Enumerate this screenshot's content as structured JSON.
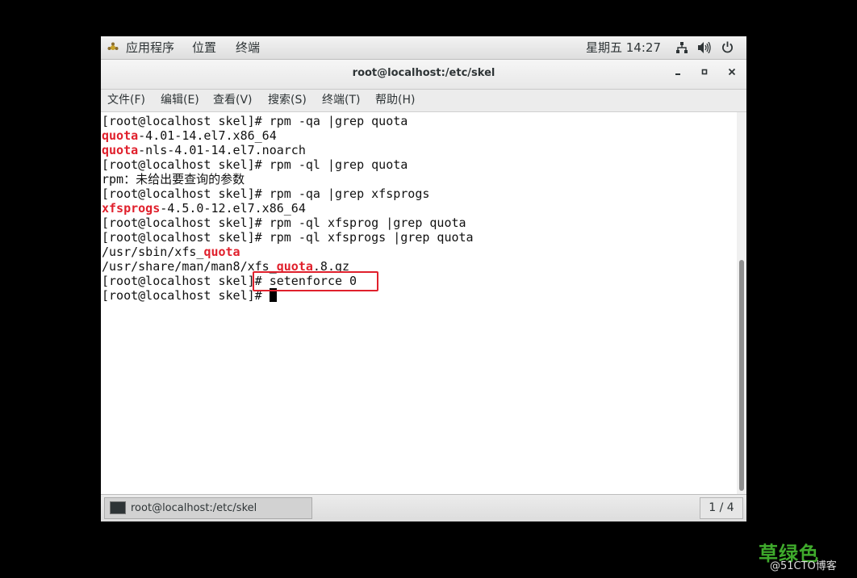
{
  "top_panel": {
    "apps_label": "应用程序",
    "places_label": "位置",
    "terminal_label": "终端",
    "clock": "星期五 14:27"
  },
  "window": {
    "title": "root@localhost:/etc/skel"
  },
  "menubar": {
    "items": [
      "文件(F)",
      "编辑(E)",
      "查看(V)",
      "搜索(S)",
      "终端(T)",
      "帮助(H)"
    ]
  },
  "terminal": {
    "lines": [
      {
        "parts": [
          {
            "t": "[root@localhost skel]# rpm -qa |grep quota"
          }
        ]
      },
      {
        "parts": [
          {
            "t": "quota",
            "red": true
          },
          {
            "t": "-4.01-14.el7.x86_64"
          }
        ]
      },
      {
        "parts": [
          {
            "t": "quota",
            "red": true
          },
          {
            "t": "-nls-4.01-14.el7.noarch"
          }
        ]
      },
      {
        "parts": [
          {
            "t": "[root@localhost skel]# rpm -ql |grep quota"
          }
        ]
      },
      {
        "parts": [
          {
            "t": "rpm：未给出要查询的参数"
          }
        ]
      },
      {
        "parts": [
          {
            "t": "[root@localhost skel]# rpm -qa |grep xfsprogs"
          }
        ]
      },
      {
        "parts": [
          {
            "t": "xfsprogs",
            "red": true
          },
          {
            "t": "-4.5.0-12.el7.x86_64"
          }
        ]
      },
      {
        "parts": [
          {
            "t": "[root@localhost skel]# rpm -ql xfsprog |grep quota"
          }
        ]
      },
      {
        "parts": [
          {
            "t": "[root@localhost skel]# rpm -ql xfsprogs |grep quota"
          }
        ]
      },
      {
        "parts": [
          {
            "t": "/usr/sbin/xfs_"
          },
          {
            "t": "quota",
            "red": true
          }
        ]
      },
      {
        "parts": [
          {
            "t": "/usr/share/man/man8/xfs_"
          },
          {
            "t": "quota",
            "red": true
          },
          {
            "t": ".8.gz"
          }
        ]
      },
      {
        "parts": [
          {
            "t": "[root@localhost skel]# setenforce 0"
          }
        ]
      },
      {
        "parts": [
          {
            "t": "[root@localhost skel]# "
          }
        ],
        "cursor": true
      }
    ]
  },
  "taskbar": {
    "task_label": "root@localhost:/etc/skel",
    "workspace": "1 / 4"
  },
  "watermark": {
    "main": "草绿色",
    "sub": "@51CTO博客"
  },
  "colors": {
    "highlight": "#e0202c",
    "watermark": "#3faa2c"
  }
}
